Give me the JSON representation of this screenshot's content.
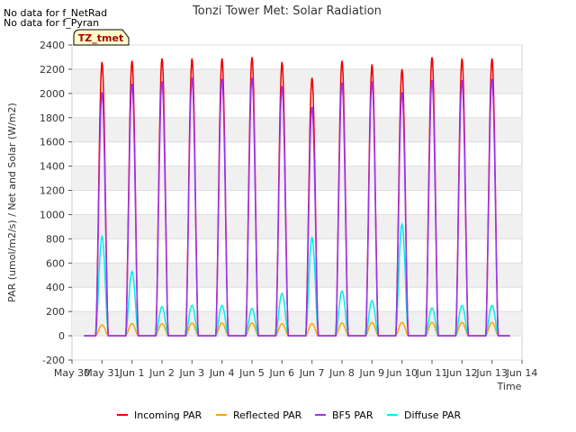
{
  "notes": [
    "No data for f_NetRad",
    "No data for f_Pyran"
  ],
  "badge": "TZ_tmet",
  "chart_data": {
    "type": "line",
    "title": "Tonzi Tower Met: Solar Radiation",
    "xlabel": "Time",
    "ylabel": "PAR (umol/m2/s) / Net and Solar (W/m2)",
    "ylim": [
      -200,
      2400
    ],
    "yticks": [
      -200,
      0,
      200,
      400,
      600,
      800,
      1000,
      1200,
      1400,
      1600,
      1800,
      2000,
      2200,
      2400
    ],
    "xlim": [
      "May 30",
      "Jun 14"
    ],
    "xticks": [
      "May 30",
      "May 31",
      "Jun 1",
      "Jun 2",
      "Jun 3",
      "Jun 4",
      "Jun 5",
      "Jun 6",
      "Jun 7",
      "Jun 8",
      "Jun 9",
      "Jun 10",
      "Jun 11",
      "Jun 12",
      "Jun 13",
      "Jun 14"
    ],
    "grid": true,
    "legend_position": "bottom",
    "days": [
      "May 30",
      "May 31",
      "Jun 1",
      "Jun 2",
      "Jun 3",
      "Jun 4",
      "Jun 5",
      "Jun 6",
      "Jun 7",
      "Jun 8",
      "Jun 9",
      "Jun 10",
      "Jun 11",
      "Jun 12",
      "Jun 13"
    ],
    "series": [
      {
        "name": "Incoming PAR",
        "color": "#ee0000",
        "daily_peak": [
          2260,
          2270,
          2290,
          2290,
          2290,
          2300,
          2260,
          2130,
          2270,
          2240,
          2200,
          2300,
          2290,
          2290
        ]
      },
      {
        "name": "Reflected PAR",
        "color": "#ffa500",
        "daily_peak": [
          90,
          100,
          100,
          105,
          105,
          105,
          100,
          100,
          105,
          110,
          110,
          110,
          110,
          110
        ]
      },
      {
        "name": "BF5 PAR",
        "color": "#9933ee",
        "daily_peak": [
          2010,
          2080,
          2100,
          2130,
          2120,
          2130,
          2060,
          1890,
          2090,
          2100,
          2010,
          2110,
          2110,
          2120
        ]
      },
      {
        "name": "Diffuse PAR",
        "color": "#00eeee",
        "daily_peak": [
          820,
          530,
          240,
          250,
          250,
          225,
          350,
          810,
          370,
          290,
          920,
          230,
          250,
          250
        ]
      }
    ]
  }
}
